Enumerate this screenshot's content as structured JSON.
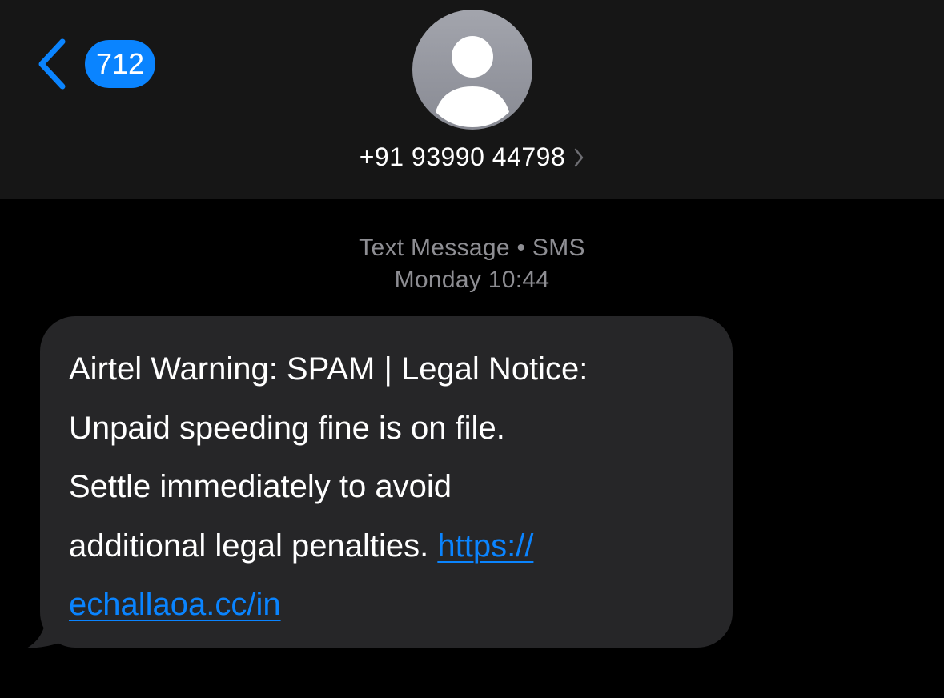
{
  "header": {
    "back_count": "712",
    "contact_name": "+91 93990 44798"
  },
  "conversation": {
    "service_label": "Text Message • SMS",
    "timestamp": "Monday 10:44"
  },
  "message": {
    "lines": [
      "Airtel Warning: SPAM | Legal Notice:",
      "Unpaid speeding fine is on file.",
      "Settle immediately to avoid"
    ],
    "line4_text": "additional legal penalties. ",
    "link_part1": "https://",
    "link_part2": "echallaoa.cc/in"
  },
  "colors": {
    "accent": "#0a84ff",
    "header_bg": "#161616",
    "bubble_bg": "#262628",
    "meta_text": "#8e8e93"
  },
  "icons": {
    "back": "chevron-left-icon",
    "avatar": "person-silhouette-icon",
    "contact_details": "chevron-right-icon"
  }
}
